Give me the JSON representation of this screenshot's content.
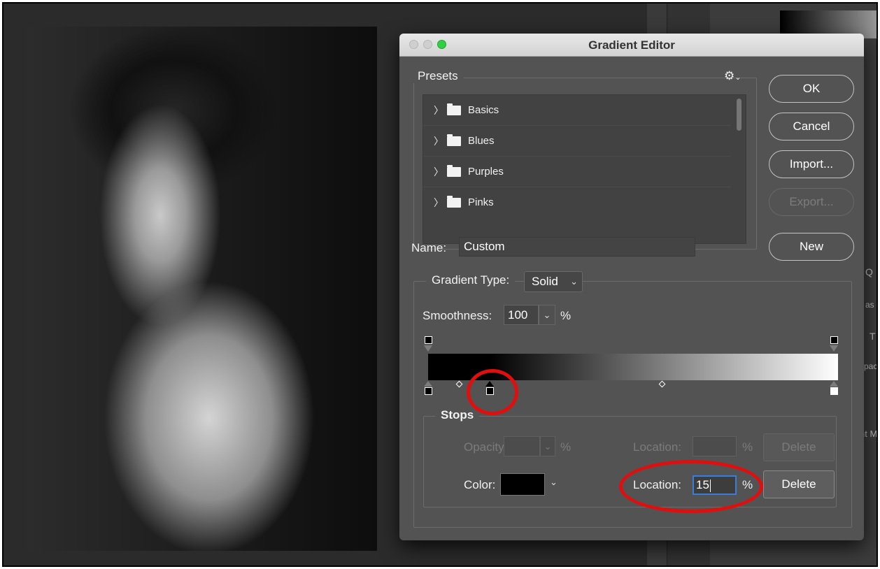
{
  "dialog": {
    "title": "Gradient Editor",
    "presets": {
      "label": "Presets",
      "menu_icon": "gear-icon",
      "items": [
        {
          "label": "Basics"
        },
        {
          "label": "Blues"
        },
        {
          "label": "Purples"
        },
        {
          "label": "Pinks"
        }
      ]
    },
    "buttons": {
      "ok": "OK",
      "cancel": "Cancel",
      "import": "Import...",
      "export": "Export...",
      "new": "New"
    },
    "name": {
      "label": "Name:",
      "value": "Custom"
    },
    "gradient_type": {
      "label": "Gradient Type:",
      "value": "Solid"
    },
    "smoothness": {
      "label": "Smoothness:",
      "value": "100",
      "unit": "%"
    },
    "gradient": {
      "color_stops": [
        {
          "location_percent": 0,
          "color": "#000000"
        },
        {
          "location_percent": 15,
          "color": "#000000",
          "selected": true
        },
        {
          "location_percent": 100,
          "color": "#ffffff"
        }
      ],
      "opacity_stops": [
        {
          "location_percent": 0,
          "color": "#000000"
        },
        {
          "location_percent": 100,
          "color": "#000000"
        }
      ]
    },
    "stops": {
      "label": "Stops",
      "opacity_label": "Opacity:",
      "opacity_unit": "%",
      "opacity_location_label": "Location:",
      "opacity_location_unit": "%",
      "opacity_delete": "Delete",
      "color_label": "Color:",
      "color_value": "#000000",
      "color_location_label": "Location:",
      "color_location_value": "15",
      "color_location_unit": "%",
      "color_delete": "Delete"
    }
  },
  "background": {
    "panel_fragments": [
      "Q",
      "as",
      "T",
      "pac",
      "nt M"
    ]
  },
  "colors": {
    "dialog_bg": "#535353",
    "accent_focus": "#3b7ed8",
    "annotation": "#e10e0e",
    "zoom_button": "#2fd043"
  }
}
